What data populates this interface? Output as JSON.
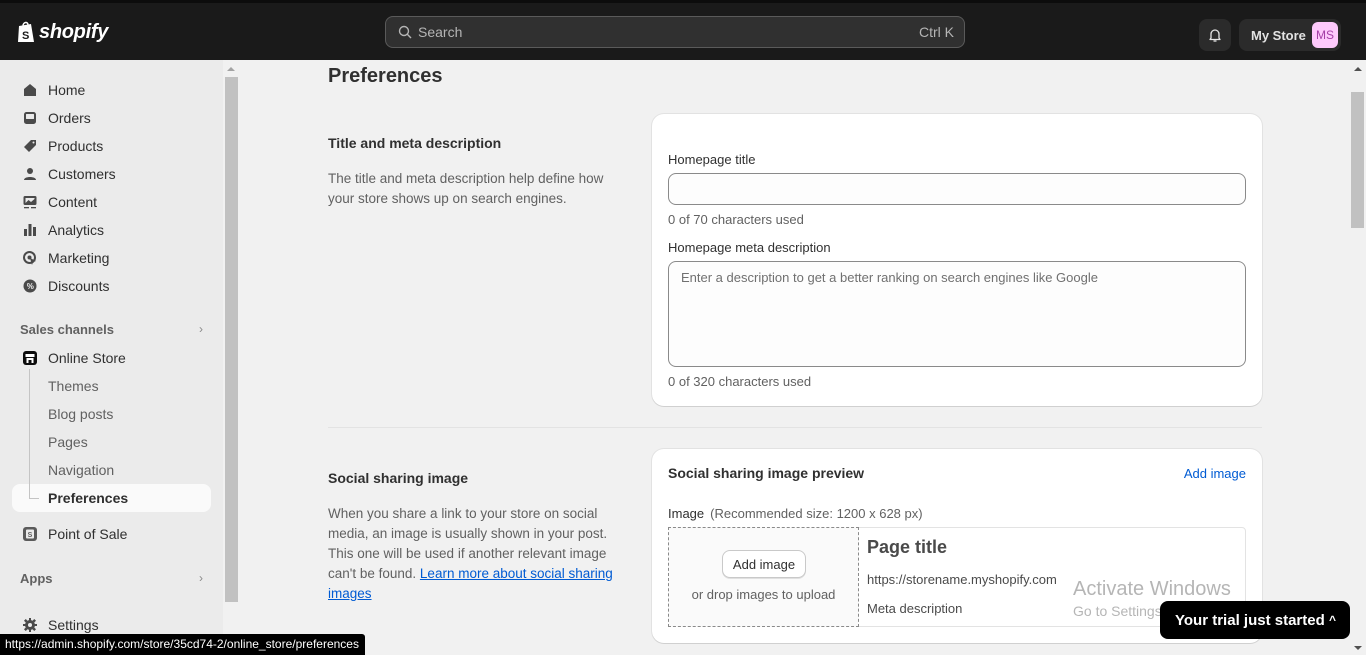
{
  "topbar": {
    "brand": "shopify",
    "search_placeholder": "Search",
    "search_shortcut": "Ctrl K",
    "notifications_icon": "bell-icon",
    "store_name": "My Store",
    "avatar_initials": "MS"
  },
  "sidebar": {
    "main_items": [
      {
        "label": "Home",
        "icon": "home-icon"
      },
      {
        "label": "Orders",
        "icon": "inbox-icon"
      },
      {
        "label": "Products",
        "icon": "tag-icon"
      },
      {
        "label": "Customers",
        "icon": "person-icon"
      },
      {
        "label": "Content",
        "icon": "image-icon"
      },
      {
        "label": "Analytics",
        "icon": "bar-chart-icon"
      },
      {
        "label": "Marketing",
        "icon": "target-icon"
      },
      {
        "label": "Discounts",
        "icon": "discount-icon"
      }
    ],
    "sales_channels_label": "Sales channels",
    "online_store": {
      "label": "Online Store",
      "sub_items": [
        "Themes",
        "Blog posts",
        "Pages",
        "Navigation",
        "Preferences"
      ],
      "active": "Preferences"
    },
    "point_of_sale": "Point of Sale",
    "apps_label": "Apps",
    "settings_label": "Settings"
  },
  "main": {
    "page_title": "Preferences",
    "title_meta_section": {
      "title": "Title and meta description",
      "description": "The title and meta description help define how your store shows up on search engines.",
      "homepage_title_label": "Homepage title",
      "homepage_title_value": "",
      "homepage_title_count": "0 of 70 characters used",
      "meta_description_label": "Homepage meta description",
      "meta_description_placeholder": "Enter a description to get a better ranking on search engines like Google",
      "meta_description_value": "",
      "meta_description_count": "0 of 320 characters used"
    },
    "social_section": {
      "title": "Social sharing image",
      "description": "When you share a link to your store on social media, an image is usually shown in your post. This one will be used if another relevant image can't be found.",
      "learn_more_link": "Learn more about social sharing images",
      "card_title": "Social sharing image preview",
      "add_image_link": "Add image",
      "image_label": "Image",
      "image_hint": "(Recommended size: 1200 x 628 px)",
      "dropzone_button": "Add image",
      "dropzone_text": "or drop images to upload",
      "preview_title": "Page title",
      "preview_url": "https://storename.myshopify.com",
      "preview_meta": "Meta description"
    }
  },
  "overlays": {
    "watermark_line1": "Activate Windows",
    "watermark_line2": "Go to Settings to activate Windows.",
    "trial_banner": "Your trial just started",
    "status_url": "https://admin.shopify.com/store/35cd74-2/online_store/preferences"
  },
  "colors": {
    "topbar_bg": "#1a1a1a",
    "sidebar_bg": "#ebebeb",
    "page_bg": "#f1f1f1",
    "link": "#005bd3",
    "avatar_bg": "#fdc9fb"
  }
}
